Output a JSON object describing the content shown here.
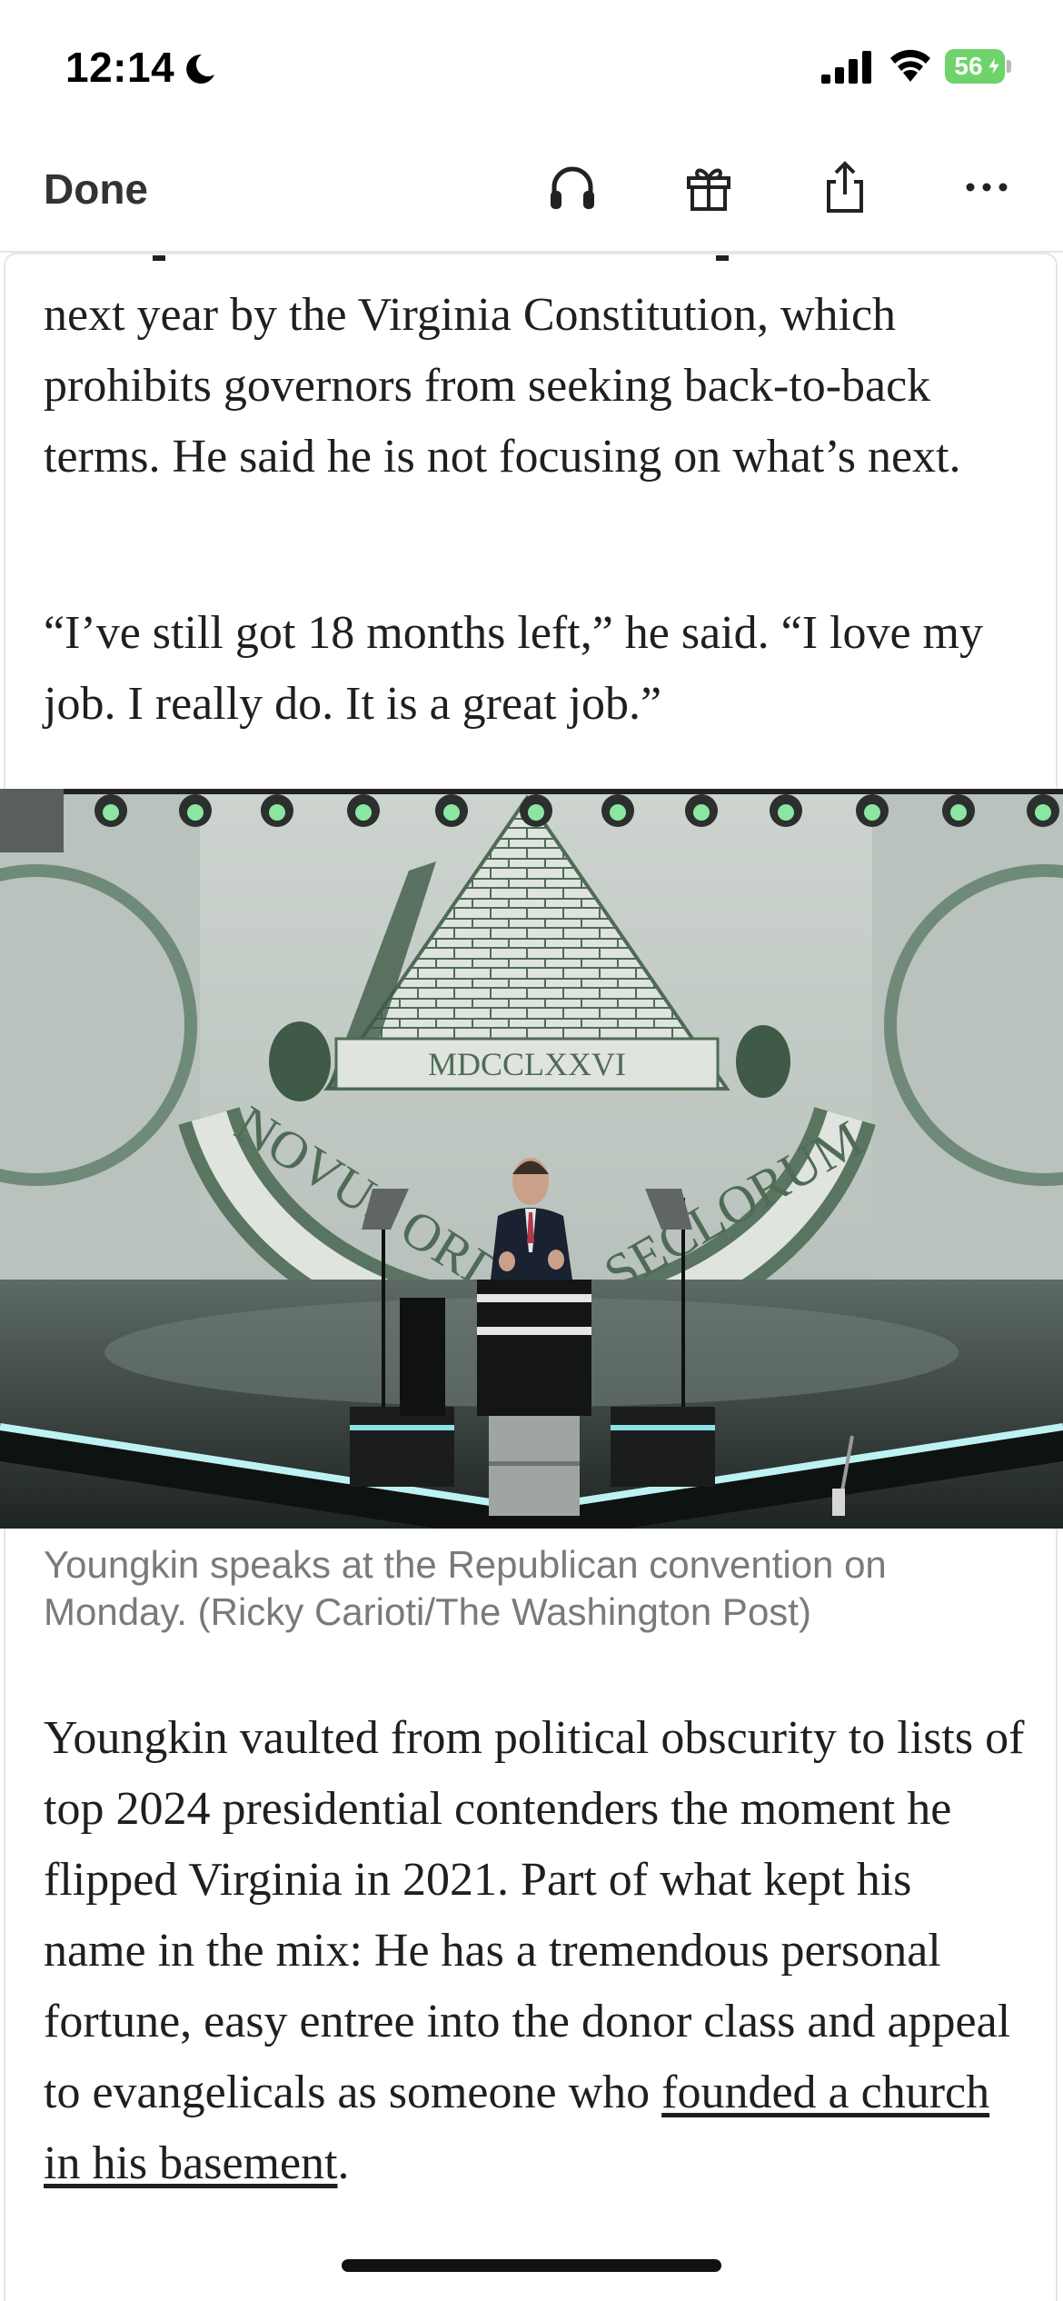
{
  "status_bar": {
    "time": "12:14",
    "battery_level": "56",
    "icons": [
      "moon-icon",
      "signal-icon",
      "wifi-icon",
      "battery-icon",
      "charging-bolt-icon"
    ]
  },
  "toolbar": {
    "done_label": "Done",
    "icons": [
      "headphones-icon",
      "gift-icon",
      "share-icon",
      "more-icon"
    ]
  },
  "article": {
    "para1": "next year by the Virginia Constitution, which prohibits governors from seeking back-to-back terms. He said he is not focusing on what’s next.",
    "para2": "“I’ve still got 18 months left,” he said. “I love my job. I really do. It is a great job.”",
    "photo": {
      "backdrop_numeral": "MDCCLXXVI",
      "backdrop_motto": "NOVUS ORDO SECLORUM",
      "colors": {
        "stage_green": "#4f6b55",
        "backdrop_light": "#d7ddd8",
        "stage_light": "#8fe0e6"
      }
    },
    "caption": "Youngkin speaks at the Republican convention on Monday. (Ricky Carioti/The Washington Post)",
    "para3_before_link": "Youngkin vaulted from political obscurity to lists of top 2024 presidential contenders the moment he flipped Virginia in 2021. Part of what kept his name in the mix: He has a tremendous personal fortune, easy entree into the donor class and appeal to evangelicals as someone who ",
    "para3_link": "founded a church in his basement",
    "para3_after_link": "."
  }
}
